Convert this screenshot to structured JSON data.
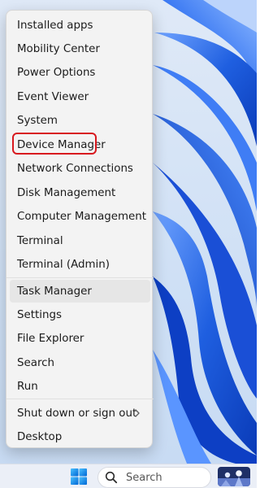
{
  "menu": {
    "items": [
      {
        "label": "Installed apps"
      },
      {
        "label": "Mobility Center"
      },
      {
        "label": "Power Options"
      },
      {
        "label": "Event Viewer"
      },
      {
        "label": "System"
      },
      {
        "label": "Device Manager",
        "highlighted": true
      },
      {
        "label": "Network Connections"
      },
      {
        "label": "Disk Management"
      },
      {
        "label": "Computer Management"
      },
      {
        "label": "Terminal"
      },
      {
        "label": "Terminal (Admin)"
      },
      {
        "label": "Task Manager",
        "hovered": true
      },
      {
        "label": "Settings"
      },
      {
        "label": "File Explorer"
      },
      {
        "label": "Search"
      },
      {
        "label": "Run"
      },
      {
        "label": "Shut down or sign out",
        "has_submenu": true
      },
      {
        "label": "Desktop"
      }
    ]
  },
  "taskbar": {
    "search_label": "Search",
    "start_icon": "windows-logo-icon",
    "search_icon": "magnifier-icon"
  },
  "colors": {
    "highlight_border": "#d8191f",
    "menu_background": "#f3f3f3",
    "wallpaper_blue": "#1f5fe0"
  }
}
